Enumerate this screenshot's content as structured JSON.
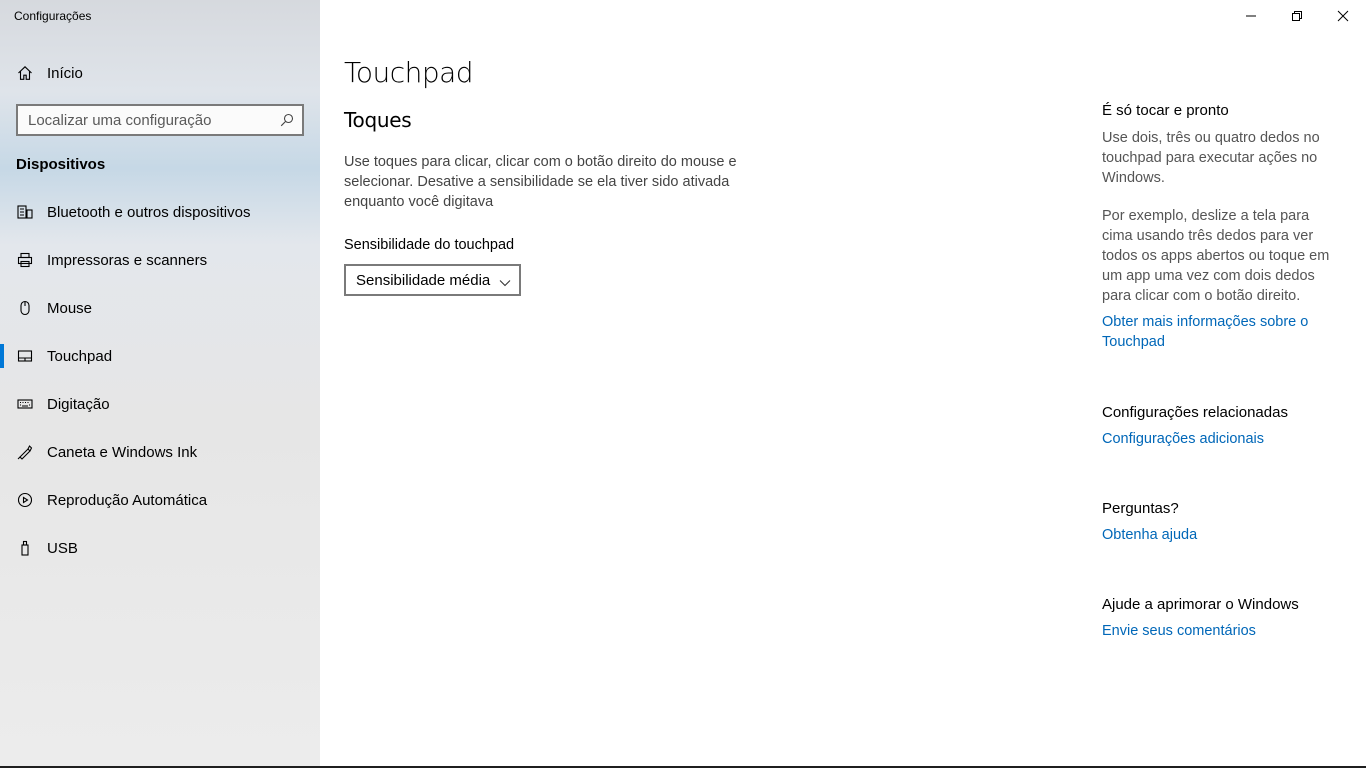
{
  "window": {
    "title": "Configurações",
    "controls": [
      "minimize",
      "restore",
      "close"
    ]
  },
  "sidebar": {
    "home_label": "Início",
    "search_placeholder": "Localizar uma configuração",
    "section": "Dispositivos",
    "items": [
      {
        "label": "Bluetooth e outros dispositivos",
        "icon": "bluetooth-devices-icon"
      },
      {
        "label": "Impressoras e scanners",
        "icon": "printer-icon"
      },
      {
        "label": "Mouse",
        "icon": "mouse-icon"
      },
      {
        "label": "Touchpad",
        "icon": "touchpad-icon",
        "selected": true
      },
      {
        "label": "Digitação",
        "icon": "keyboard-icon"
      },
      {
        "label": "Caneta e Windows Ink",
        "icon": "pen-icon"
      },
      {
        "label": "Reprodução Automática",
        "icon": "autoplay-icon"
      },
      {
        "label": "USB",
        "icon": "usb-icon"
      }
    ],
    "accent_color": "#0078d7"
  },
  "main": {
    "title": "Touchpad",
    "section_title": "Toques",
    "description": "Use toques para clicar, clicar com o botão direito do mouse e selecionar. Desative a sensibilidade se ela tiver sido ativada enquanto você digitava",
    "sensitivity_label": "Sensibilidade do touchpad",
    "sensitivity_value": "Sensibilidade média"
  },
  "aside": {
    "tip_heading": "É só tocar e pronto",
    "tip_text_1": "Use dois, três ou quatro dedos no touchpad para executar ações no Windows.",
    "tip_text_2": "Por exemplo, deslize a tela para cima usando três dedos para ver todos os apps abertos ou toque em um app uma vez com dois dedos para clicar com o botão direito.",
    "tip_link": "Obter mais informações sobre o Touchpad",
    "related_heading": "Configurações relacionadas",
    "related_link": "Configurações adicionais",
    "questions_heading": "Perguntas?",
    "questions_link": "Obtenha ajuda",
    "feedback_heading": "Ajude a aprimorar o Windows",
    "feedback_link": "Envie seus comentários",
    "link_color": "#0067b8"
  }
}
